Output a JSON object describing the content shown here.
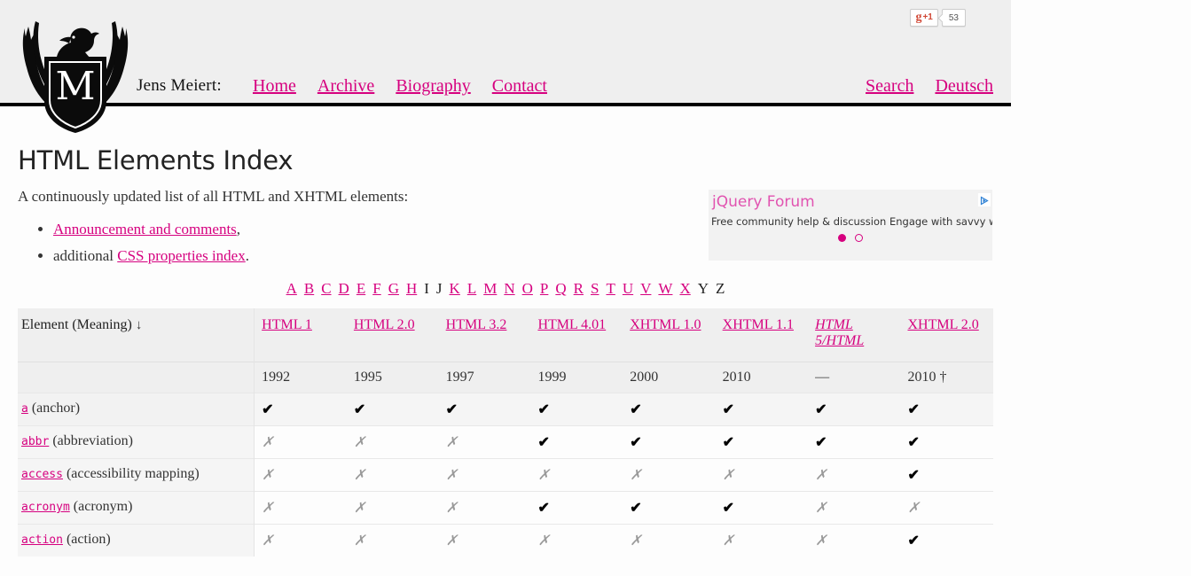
{
  "header": {
    "brand": "Jens Meiert:",
    "logo_icon": "eagle-shield-m-logo",
    "nav": [
      {
        "label": "Home"
      },
      {
        "label": "Archive"
      },
      {
        "label": "Biography"
      },
      {
        "label": "Contact"
      }
    ],
    "util_nav": [
      {
        "label": "Search"
      },
      {
        "label": "Deutsch"
      }
    ],
    "gplus": {
      "g_letter": "g",
      "plus": "+1",
      "count": "53"
    }
  },
  "main": {
    "title": "HTML Elements Index",
    "intro": "A continuously updated list of all HTML and XHTML elements:",
    "bullets": [
      {
        "link": "Announcement and comments",
        "after": ",",
        "before": ""
      },
      {
        "link": "CSS properties index",
        "after": ".",
        "before": "additional "
      }
    ]
  },
  "ad": {
    "title": "jQuery Forum",
    "text": "Free community help & discussion Engage with savvy web developers",
    "badge_icon": "adchoices-icon"
  },
  "alphabet": {
    "letters": [
      {
        "ch": "A",
        "link": true
      },
      {
        "ch": "B",
        "link": true
      },
      {
        "ch": "C",
        "link": true
      },
      {
        "ch": "D",
        "link": true
      },
      {
        "ch": "E",
        "link": true
      },
      {
        "ch": "F",
        "link": true
      },
      {
        "ch": "G",
        "link": true
      },
      {
        "ch": "H",
        "link": true
      },
      {
        "ch": "I",
        "link": false
      },
      {
        "ch": "J",
        "link": false
      },
      {
        "ch": "K",
        "link": true
      },
      {
        "ch": "L",
        "link": true
      },
      {
        "ch": "M",
        "link": true
      },
      {
        "ch": "N",
        "link": true
      },
      {
        "ch": "O",
        "link": true
      },
      {
        "ch": "P",
        "link": true
      },
      {
        "ch": "Q",
        "link": true
      },
      {
        "ch": "R",
        "link": true
      },
      {
        "ch": "S",
        "link": true
      },
      {
        "ch": "T",
        "link": true
      },
      {
        "ch": "U",
        "link": true
      },
      {
        "ch": "V",
        "link": true
      },
      {
        "ch": "W",
        "link": true
      },
      {
        "ch": "X",
        "link": true
      },
      {
        "ch": "Y",
        "link": false
      },
      {
        "ch": "Z",
        "link": false
      }
    ]
  },
  "table": {
    "element_column_header": "Element (Meaning)",
    "sort_arrow": "↓",
    "columns": [
      {
        "label": "HTML 1",
        "italic": false,
        "year": "1992"
      },
      {
        "label": "HTML 2.0",
        "italic": false,
        "year": "1995"
      },
      {
        "label": "HTML 3.2",
        "italic": false,
        "year": "1997"
      },
      {
        "label": "HTML 4.01",
        "italic": false,
        "year": "1999"
      },
      {
        "label": "XHTML 1.0",
        "italic": false,
        "year": "2000"
      },
      {
        "label": "XHTML 1.1",
        "italic": false,
        "year": "2010"
      },
      {
        "label": "HTML 5/HTML",
        "italic": true,
        "year": "—"
      },
      {
        "label": "XHTML 2.0",
        "italic": false,
        "year": "2010 †"
      }
    ],
    "yes_glyph": "✔",
    "no_glyph": "✗",
    "rows": [
      {
        "element": "a",
        "meaning": "(anchor)",
        "support": [
          "yes",
          "yes",
          "yes",
          "yes",
          "yes",
          "yes",
          "yes",
          "yes"
        ]
      },
      {
        "element": "abbr",
        "meaning": "(abbreviation)",
        "support": [
          "no",
          "no",
          "no",
          "yes",
          "yes",
          "yes",
          "yes",
          "yes"
        ]
      },
      {
        "element": "access",
        "meaning": "(accessibility mapping)",
        "support": [
          "no",
          "no",
          "no",
          "no",
          "no",
          "no",
          "no",
          "yes"
        ]
      },
      {
        "element": "acronym",
        "meaning": "(acronym)",
        "support": [
          "no",
          "no",
          "no",
          "yes",
          "yes",
          "yes",
          "no",
          "no"
        ]
      },
      {
        "element": "action",
        "meaning": "(action)",
        "support": [
          "no",
          "no",
          "no",
          "no",
          "no",
          "no",
          "no",
          "yes"
        ]
      }
    ]
  },
  "colors": {
    "link": "#d6007f",
    "header_bg": "#efefef",
    "page_bg": "#fdfdfd",
    "ad_title": "#e153b0"
  }
}
